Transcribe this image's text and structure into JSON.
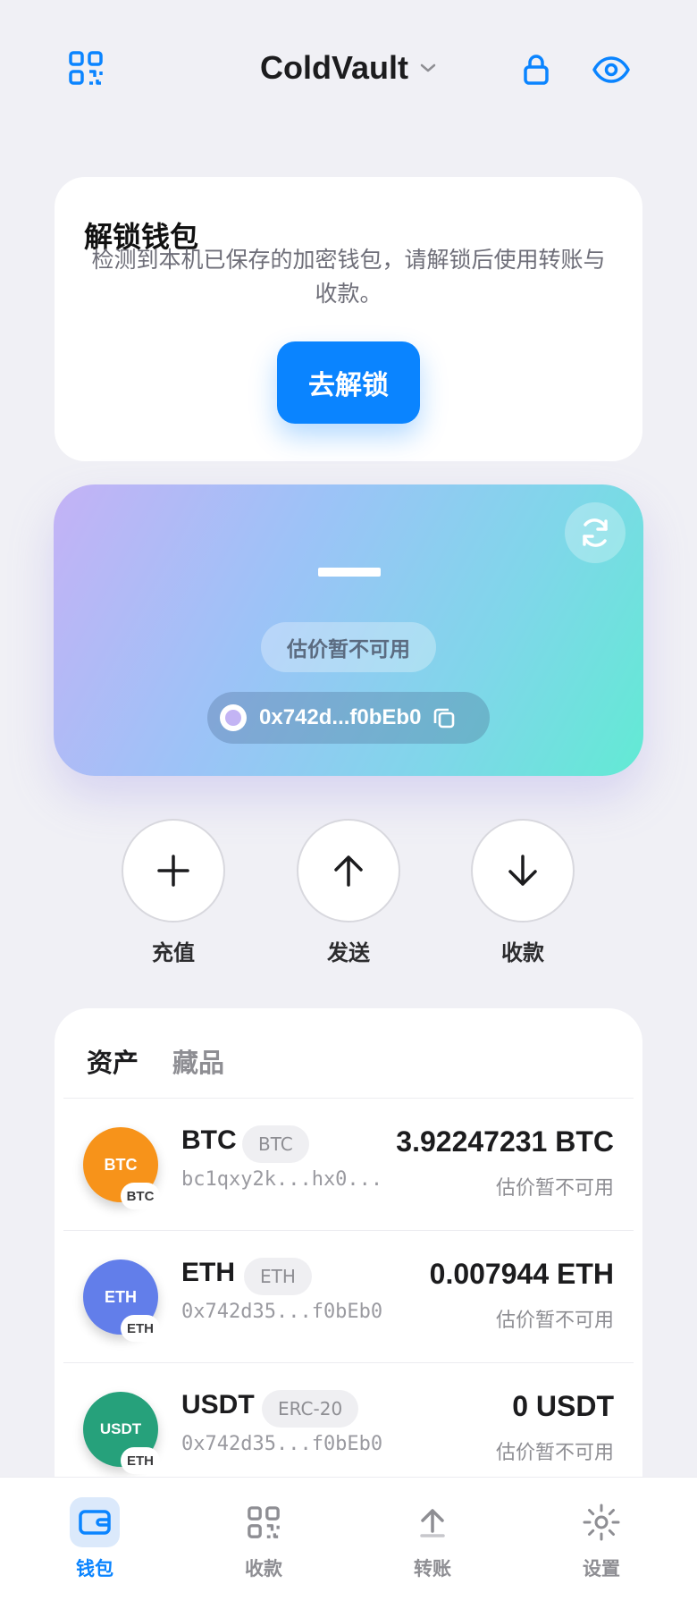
{
  "header": {
    "wallet_name": "ColdVault",
    "icons": [
      "qr-scan-icon",
      "chevron-down-icon",
      "lock-icon",
      "eye-icon"
    ],
    "accent_color": "#0a84ff"
  },
  "unlock_card": {
    "title": "解锁钱包",
    "description": "检测到本机已保存的加密钱包，请解锁后使用转账与收款。",
    "button_label": "去解锁"
  },
  "balance_card": {
    "balance_placeholder": "—",
    "estimate_label": "估价暂不可用",
    "address_short": "0x742d...f0bEb0",
    "icons": [
      "refresh-icon",
      "copy-icon"
    ]
  },
  "actions": [
    {
      "label": "充值",
      "icon": "plus-icon"
    },
    {
      "label": "发送",
      "icon": "arrow-up-icon"
    },
    {
      "label": "收款",
      "icon": "arrow-down-icon"
    }
  ],
  "assets_panel": {
    "tabs": [
      {
        "label": "资产",
        "active": true
      },
      {
        "label": "藏品",
        "active": false
      }
    ],
    "assets": [
      {
        "symbol": "BTC",
        "coin_label": "BTC",
        "badge": "BTC",
        "chain": "BTC",
        "address": "bc1qxy2k...hx0...",
        "amount": "3.92247231 BTC",
        "value": "估价暂不可用",
        "color": "#f7931a"
      },
      {
        "symbol": "ETH",
        "coin_label": "ETH",
        "badge": "ETH",
        "chain": "ETH",
        "address": "0x742d35...f0bEb0",
        "amount": "0.007944 ETH",
        "value": "估价暂不可用",
        "color": "#627eea"
      },
      {
        "symbol": "USDT",
        "coin_label": "USDT",
        "badge": "ETH",
        "chain": "ERC-20",
        "address": "0x742d35...f0bEb0",
        "amount": "0 USDT",
        "value": "估价暂不可用",
        "color": "#26a17b"
      }
    ]
  },
  "bottom_nav": [
    {
      "label": "钱包",
      "icon": "wallet-icon",
      "active": true
    },
    {
      "label": "收款",
      "icon": "qr-code-icon",
      "active": false
    },
    {
      "label": "转账",
      "icon": "transfer-up-icon",
      "active": false
    },
    {
      "label": "设置",
      "icon": "settings-sun-icon",
      "active": false
    }
  ]
}
